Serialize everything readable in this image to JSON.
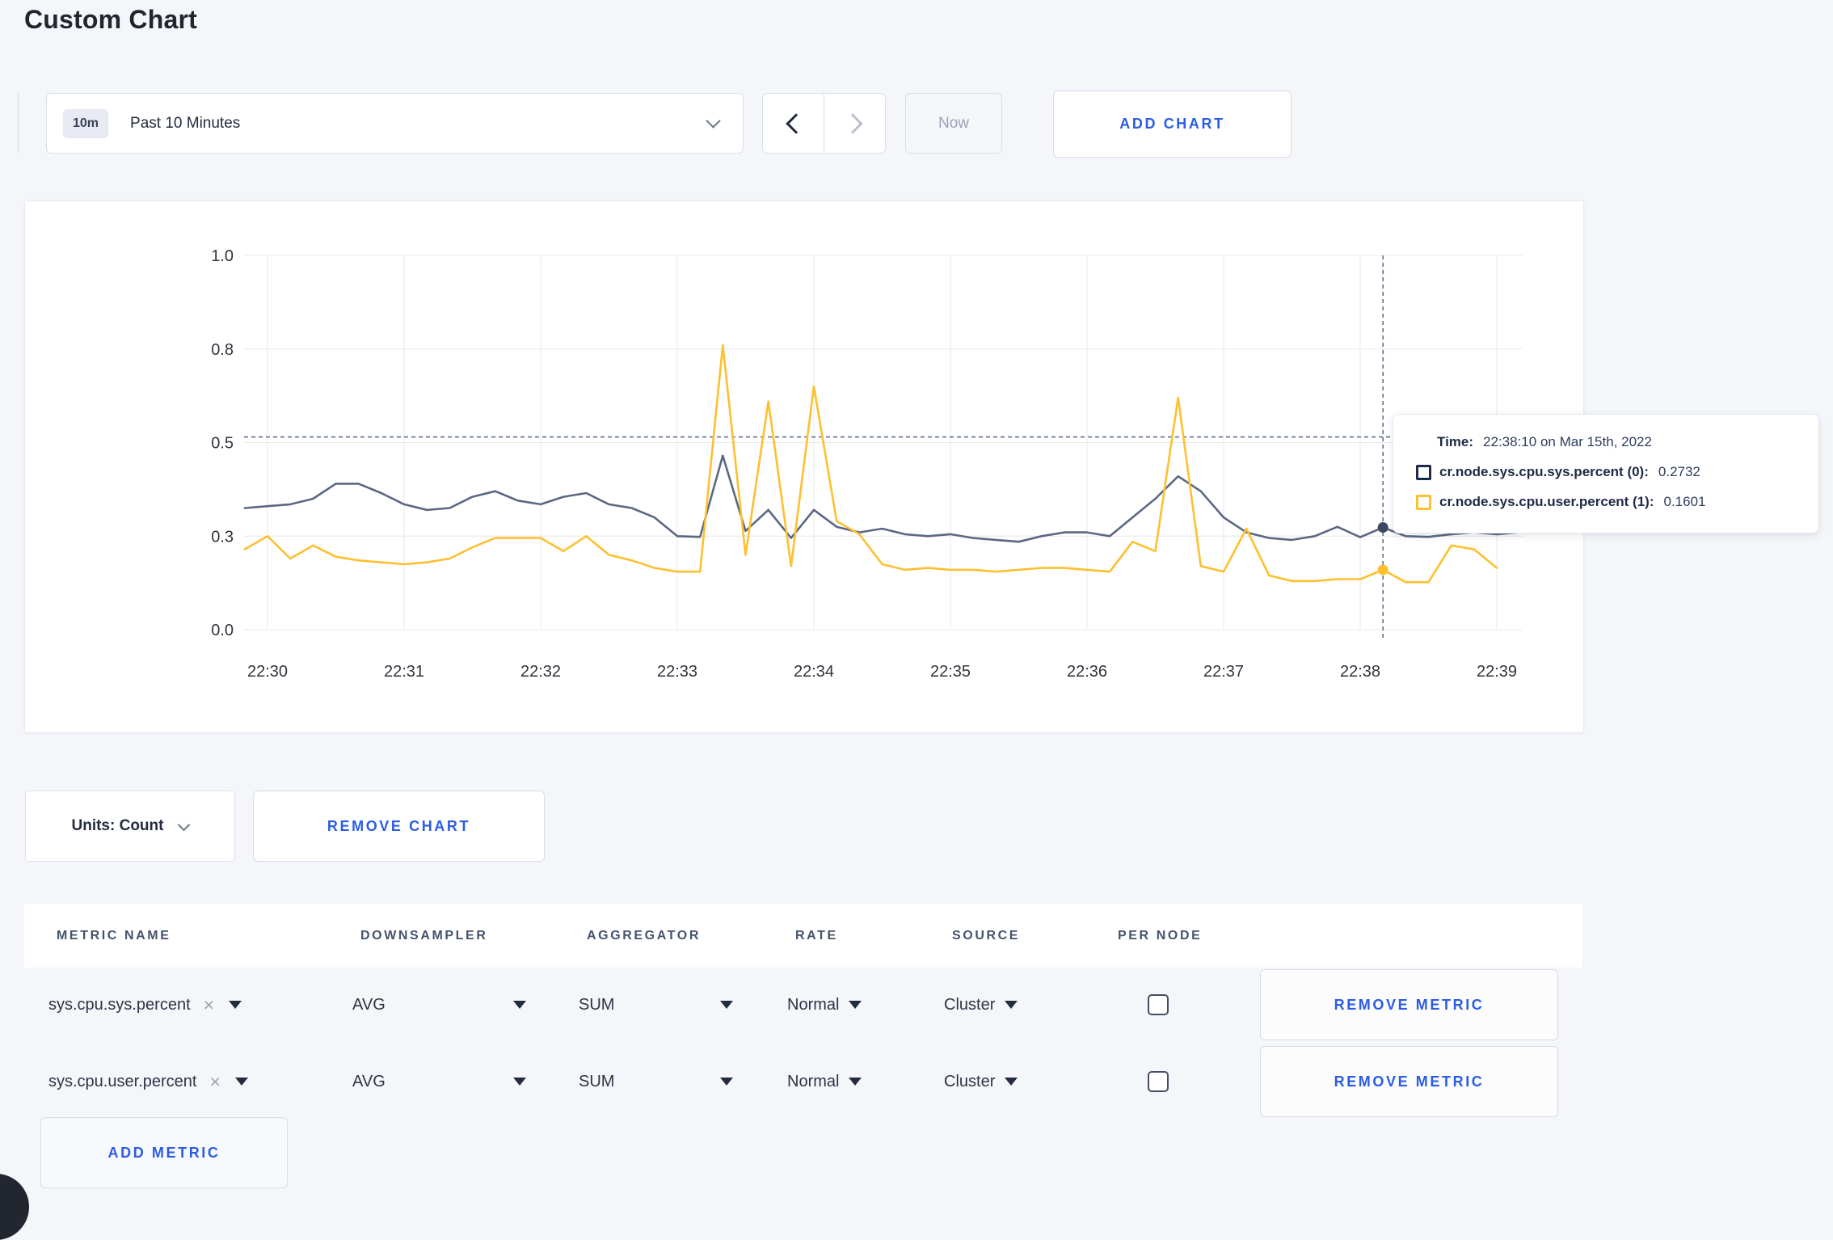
{
  "page": {
    "title": "Custom Chart",
    "background": "#f5f6fa",
    "accent_blue": "#2b5ce3"
  },
  "toolbar": {
    "range_badge": "10m",
    "range_label": "Past 10 Minutes",
    "now_label": "Now",
    "add_chart_label": "ADD CHART"
  },
  "tooltip": {
    "time_label": "Time:",
    "time_value": "22:38:10 on Mar 15th, 2022",
    "series": [
      {
        "label": "cr.node.sys.cpu.sys.percent (0):",
        "value": "0.2732",
        "color": "#1c2b4a"
      },
      {
        "label": "cr.node.sys.cpu.user.percent (1):",
        "value": "0.1601",
        "color": "#fdc02f"
      }
    ]
  },
  "chart_footer": {
    "units_label": "Units: Count",
    "remove_chart_label": "REMOVE CHART"
  },
  "metrics_table": {
    "columns": [
      "METRIC NAME",
      "DOWNSAMPLER",
      "AGGREGATOR",
      "RATE",
      "SOURCE",
      "PER NODE"
    ],
    "rows": [
      {
        "metric": "sys.cpu.sys.percent",
        "downsampler": "AVG",
        "aggregator": "SUM",
        "rate": "Normal",
        "source": "Cluster",
        "per_node_checked": false,
        "remove_label": "REMOVE METRIC"
      },
      {
        "metric": "sys.cpu.user.percent",
        "downsampler": "AVG",
        "aggregator": "SUM",
        "rate": "Normal",
        "source": "Cluster",
        "per_node_checked": false,
        "remove_label": "REMOVE METRIC"
      }
    ],
    "add_metric_label": "ADD METRIC"
  },
  "chart_data": {
    "type": "line",
    "title": "",
    "xlabel": "time",
    "ylabel": "",
    "ylim": [
      0,
      1
    ],
    "grid": true,
    "legend_position": "tooltip",
    "y_ticks": [
      {
        "v": 0,
        "label": "0.0"
      },
      {
        "v": 0.25,
        "label": "0.3"
      },
      {
        "v": 0.5,
        "label": "0.5"
      },
      {
        "v": 0.75,
        "label": "0.8"
      },
      {
        "v": 1.0,
        "label": "1.0"
      }
    ],
    "x_ticks": [
      {
        "sec": 0,
        "label": "22:30"
      },
      {
        "sec": 60,
        "label": "22:31"
      },
      {
        "sec": 120,
        "label": "22:32"
      },
      {
        "sec": 180,
        "label": "22:33"
      },
      {
        "sec": 240,
        "label": "22:34"
      },
      {
        "sec": 300,
        "label": "22:35"
      },
      {
        "sec": 360,
        "label": "22:36"
      },
      {
        "sec": 420,
        "label": "22:37"
      },
      {
        "sec": 480,
        "label": "22:38"
      },
      {
        "sec": 540,
        "label": "22:39"
      }
    ],
    "crosshair": {
      "t_sec": 490,
      "time": "22:38:10",
      "value_line": 0.515
    },
    "series": [
      {
        "id": "sys",
        "name": "cr.node.sys.cpu.sys.percent",
        "color": "#5b6882",
        "dot_color": "#3d4961",
        "start_sec": -10,
        "step_sec": 10,
        "values": [
          0.325,
          0.33,
          0.335,
          0.35,
          0.39,
          0.39,
          0.365,
          0.335,
          0.32,
          0.325,
          0.355,
          0.37,
          0.345,
          0.335,
          0.355,
          0.365,
          0.335,
          0.325,
          0.3,
          0.25,
          0.248,
          0.465,
          0.264,
          0.32,
          0.245,
          0.32,
          0.275,
          0.26,
          0.27,
          0.255,
          0.25,
          0.255,
          0.245,
          0.24,
          0.235,
          0.25,
          0.26,
          0.26,
          0.25,
          0.3,
          0.35,
          0.41,
          0.37,
          0.3,
          0.26,
          0.245,
          0.24,
          0.25,
          0.275,
          0.247,
          0.2732,
          0.25,
          0.248,
          0.255,
          0.26,
          0.255,
          0.26
        ]
      },
      {
        "id": "user",
        "name": "cr.node.sys.cpu.user.percent",
        "color": "#fdc02f",
        "dot_color": "#fdc02f",
        "start_sec": -10,
        "step_sec": 10,
        "values": [
          0.215,
          0.25,
          0.19,
          0.225,
          0.195,
          0.185,
          0.18,
          0.175,
          0.18,
          0.19,
          0.22,
          0.245,
          0.245,
          0.245,
          0.21,
          0.25,
          0.2,
          0.185,
          0.165,
          0.155,
          0.155,
          0.76,
          0.2,
          0.61,
          0.17,
          0.65,
          0.29,
          0.255,
          0.175,
          0.16,
          0.165,
          0.16,
          0.16,
          0.155,
          0.16,
          0.165,
          0.165,
          0.16,
          0.155,
          0.235,
          0.21,
          0.62,
          0.17,
          0.155,
          0.27,
          0.145,
          0.13,
          0.13,
          0.135,
          0.135,
          0.1601,
          0.127,
          0.127,
          0.225,
          0.215,
          0.165
        ]
      }
    ]
  }
}
